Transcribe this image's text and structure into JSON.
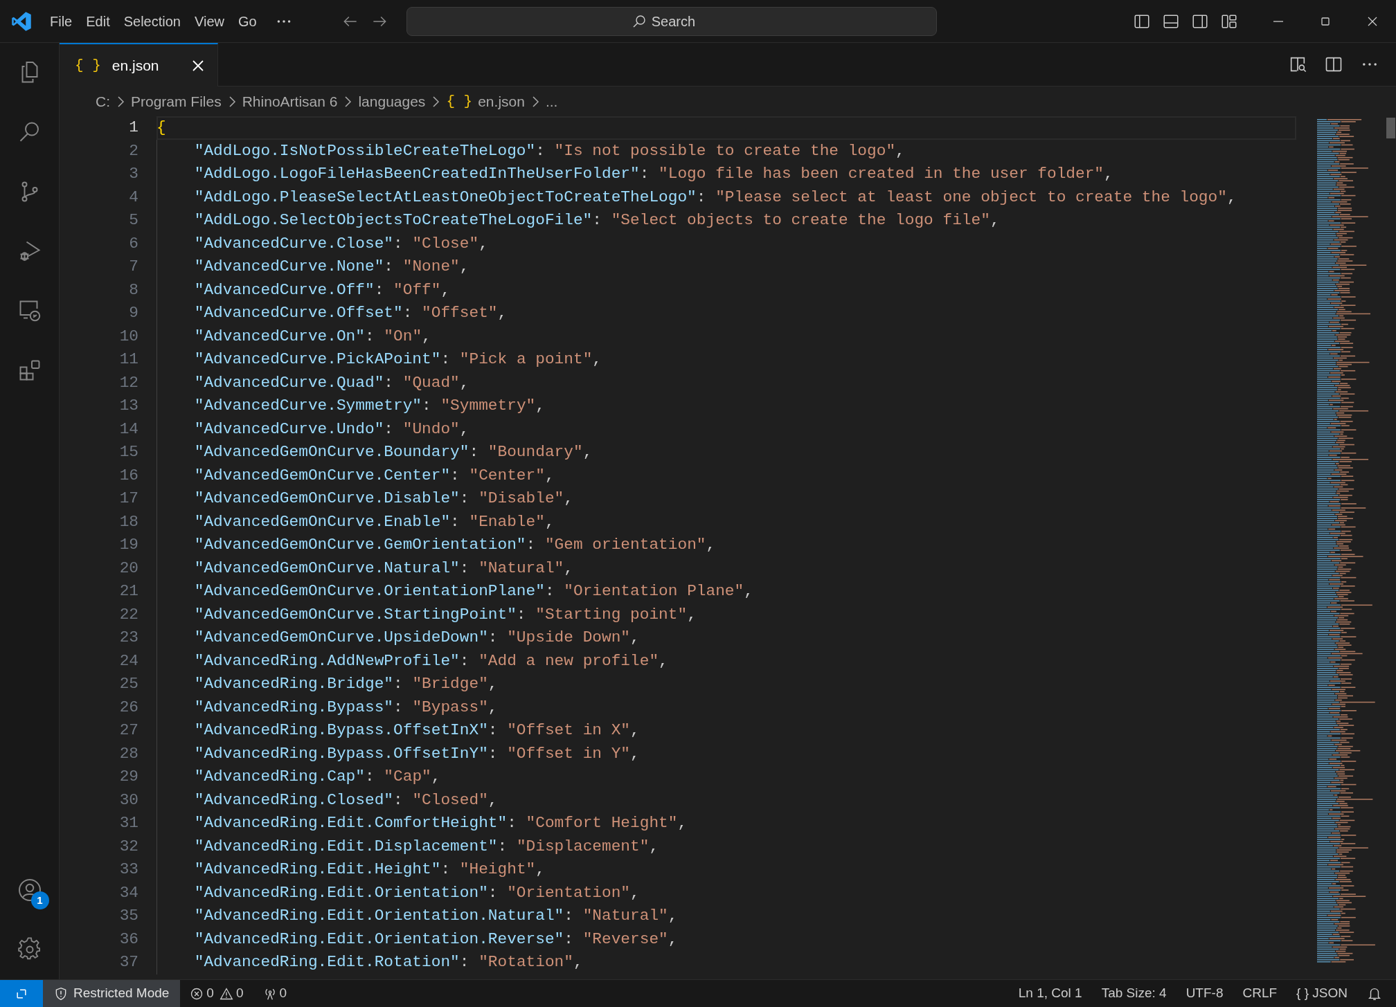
{
  "title_bar": {
    "menu": [
      "File",
      "Edit",
      "Selection",
      "View",
      "Go"
    ],
    "search": {
      "placeholder": "Search"
    }
  },
  "tabs": [
    {
      "icon": "{ }",
      "label": "en.json",
      "selected": true
    }
  ],
  "breadcrumb": [
    {
      "label": "C:"
    },
    {
      "label": "Program Files"
    },
    {
      "label": "RhinoArtisan 6"
    },
    {
      "label": "languages"
    },
    {
      "icon": "{ }",
      "label": "en.json"
    },
    {
      "label": "..."
    }
  ],
  "activity_bar": {
    "account_badge": "1"
  },
  "editor": {
    "lines": [
      {
        "number": "1",
        "text": "{",
        "current": true,
        "children": [
          {
            "number": "2",
            "key": "\"AddLogo.IsNotPossibleCreateTheLogo\"",
            "colon": ":",
            "value": "\"Is not possible to create the logo\"",
            "comma": ",",
            "current": false
          },
          {
            "number": "3",
            "key": "\"AddLogo.LogoFileHasBeenCreatedInTheUserFolder\"",
            "colon": ":",
            "value": "\"Logo file has been created in the user folder\"",
            "comma": ",",
            "current": false
          },
          {
            "number": "4",
            "key": "\"AddLogo.PleaseSelectAtLeastOneObjectToCreateTheLogo\"",
            "colon": ":",
            "value": "\"Please select at least one object to create the logo\"",
            "comma": ",",
            "current": false
          },
          {
            "number": "5",
            "key": "\"AddLogo.SelectObjectsToCreateTheLogoFile\"",
            "colon": ":",
            "value": "\"Select objects to create the logo file\"",
            "comma": ",",
            "current": false
          },
          {
            "number": "6",
            "key": "\"AdvancedCurve.Close\"",
            "colon": ":",
            "value": "\"Close\"",
            "comma": ",",
            "current": false
          },
          {
            "number": "7",
            "key": "\"AdvancedCurve.None\"",
            "colon": ":",
            "value": "\"None\"",
            "comma": ",",
            "current": false
          },
          {
            "number": "8",
            "key": "\"AdvancedCurve.Off\"",
            "colon": ":",
            "value": "\"Off\"",
            "comma": ",",
            "current": false
          },
          {
            "number": "9",
            "key": "\"AdvancedCurve.Offset\"",
            "colon": ":",
            "value": "\"Offset\"",
            "comma": ",",
            "current": false
          },
          {
            "number": "10",
            "key": "\"AdvancedCurve.On\"",
            "colon": ":",
            "value": "\"On\"",
            "comma": ",",
            "current": false
          },
          {
            "number": "11",
            "key": "\"AdvancedCurve.PickAPoint\"",
            "colon": ":",
            "value": "\"Pick a point\"",
            "comma": ",",
            "current": false
          },
          {
            "number": "12",
            "key": "\"AdvancedCurve.Quad\"",
            "colon": ":",
            "value": "\"Quad\"",
            "comma": ",",
            "current": false
          },
          {
            "number": "13",
            "key": "\"AdvancedCurve.Symmetry\"",
            "colon": ":",
            "value": "\"Symmetry\"",
            "comma": ",",
            "current": false
          },
          {
            "number": "14",
            "key": "\"AdvancedCurve.Undo\"",
            "colon": ":",
            "value": "\"Undo\"",
            "comma": ",",
            "current": false
          },
          {
            "number": "15",
            "key": "\"AdvancedGemOnCurve.Boundary\"",
            "colon": ":",
            "value": "\"Boundary\"",
            "comma": ",",
            "current": false
          },
          {
            "number": "16",
            "key": "\"AdvancedGemOnCurve.Center\"",
            "colon": ":",
            "value": "\"Center\"",
            "comma": ",",
            "current": false
          },
          {
            "number": "17",
            "key": "\"AdvancedGemOnCurve.Disable\"",
            "colon": ":",
            "value": "\"Disable\"",
            "comma": ",",
            "current": false
          },
          {
            "number": "18",
            "key": "\"AdvancedGemOnCurve.Enable\"",
            "colon": ":",
            "value": "\"Enable\"",
            "comma": ",",
            "current": false
          },
          {
            "number": "19",
            "key": "\"AdvancedGemOnCurve.GemOrientation\"",
            "colon": ":",
            "value": "\"Gem orientation\"",
            "comma": ",",
            "current": false
          },
          {
            "number": "20",
            "key": "\"AdvancedGemOnCurve.Natural\"",
            "colon": ":",
            "value": "\"Natural\"",
            "comma": ",",
            "current": false
          },
          {
            "number": "21",
            "key": "\"AdvancedGemOnCurve.OrientationPlane\"",
            "colon": ":",
            "value": "\"Orientation Plane\"",
            "comma": ",",
            "current": false
          },
          {
            "number": "22",
            "key": "\"AdvancedGemOnCurve.StartingPoint\"",
            "colon": ":",
            "value": "\"Starting point\"",
            "comma": ",",
            "current": false
          },
          {
            "number": "23",
            "key": "\"AdvancedGemOnCurve.UpsideDown\"",
            "colon": ":",
            "value": "\"Upside Down\"",
            "comma": ",",
            "current": false
          },
          {
            "number": "24",
            "key": "\"AdvancedRing.AddNewProfile\"",
            "colon": ":",
            "value": "\"Add a new profile\"",
            "comma": ",",
            "current": false
          },
          {
            "number": "25",
            "key": "\"AdvancedRing.Bridge\"",
            "colon": ":",
            "value": "\"Bridge\"",
            "comma": ",",
            "current": false
          },
          {
            "number": "26",
            "key": "\"AdvancedRing.Bypass\"",
            "colon": ":",
            "value": "\"Bypass\"",
            "comma": ",",
            "current": false
          },
          {
            "number": "27",
            "key": "\"AdvancedRing.Bypass.OffsetInX\"",
            "colon": ":",
            "value": "\"Offset in X\"",
            "comma": ",",
            "current": false
          },
          {
            "number": "28",
            "key": "\"AdvancedRing.Bypass.OffsetInY\"",
            "colon": ":",
            "value": "\"Offset in Y\"",
            "comma": ",",
            "current": false
          },
          {
            "number": "29",
            "key": "\"AdvancedRing.Cap\"",
            "colon": ":",
            "value": "\"Cap\"",
            "comma": ",",
            "current": false
          },
          {
            "number": "30",
            "key": "\"AdvancedRing.Closed\"",
            "colon": ":",
            "value": "\"Closed\"",
            "comma": ",",
            "current": false
          },
          {
            "number": "31",
            "key": "\"AdvancedRing.Edit.ComfortHeight\"",
            "colon": ":",
            "value": "\"Comfort Height\"",
            "comma": ",",
            "current": false
          },
          {
            "number": "32",
            "key": "\"AdvancedRing.Edit.Displacement\"",
            "colon": ":",
            "value": "\"Displacement\"",
            "comma": ",",
            "current": false
          },
          {
            "number": "33",
            "key": "\"AdvancedRing.Edit.Height\"",
            "colon": ":",
            "value": "\"Height\"",
            "comma": ",",
            "current": false
          },
          {
            "number": "34",
            "key": "\"AdvancedRing.Edit.Orientation\"",
            "colon": ":",
            "value": "\"Orientation\"",
            "comma": ",",
            "current": false
          },
          {
            "number": "35",
            "key": "\"AdvancedRing.Edit.Orientation.Natural\"",
            "colon": ":",
            "value": "\"Natural\"",
            "comma": ",",
            "current": false
          },
          {
            "number": "36",
            "key": "\"AdvancedRing.Edit.Orientation.Reverse\"",
            "colon": ":",
            "value": "\"Reverse\"",
            "comma": ",",
            "current": false
          },
          {
            "number": "37",
            "key": "\"AdvancedRing.Edit.Rotation\"",
            "colon": ":",
            "value": "\"Rotation\"",
            "comma": ",",
            "current": false
          }
        ]
      }
    ]
  },
  "status_bar": {
    "restricted_mode": "Restricted Mode",
    "errors": "0",
    "warnings": "0",
    "ports": "0",
    "position": "Ln 1, Col 1",
    "tab_size": "Tab Size: 4",
    "encoding": "UTF-8",
    "line_ending": "CRLF",
    "language_icon": "{ }",
    "language": "JSON"
  }
}
